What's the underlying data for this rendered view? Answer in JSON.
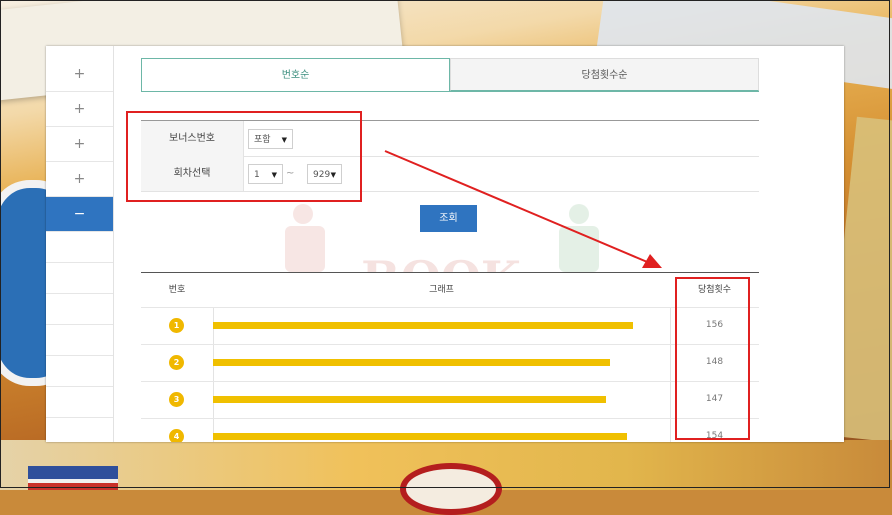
{
  "sidebar": {
    "items": [
      {
        "symbol": "+"
      },
      {
        "symbol": "+"
      },
      {
        "symbol": "+"
      },
      {
        "symbol": "+"
      },
      {
        "symbol": "−"
      }
    ]
  },
  "tabs": [
    {
      "label": "번호순"
    },
    {
      "label": "당첨횟수순"
    }
  ],
  "filter": {
    "bonus_label": "보너스번호",
    "bonus_value": "포함",
    "round_label": "회차선택",
    "round_from": "1",
    "round_separator": "~",
    "round_to": "929"
  },
  "search_label": "조회",
  "watermark": "BOOK",
  "table": {
    "headers": [
      "번호",
      "그래프",
      "당첨횟수"
    ],
    "rows": [
      {
        "number": "1",
        "count": "156",
        "fraction": 1.0
      },
      {
        "number": "2",
        "count": "148",
        "fraction": 0.945
      },
      {
        "number": "3",
        "count": "147",
        "fraction": 0.935
      },
      {
        "number": "4",
        "count": "154",
        "fraction": 0.985
      }
    ]
  },
  "colors": {
    "accent": "#2f74c0",
    "ball": "#f0b800",
    "bar": "#f0c000",
    "tab_active": "#6db7a7",
    "annotation": "#e02020"
  }
}
